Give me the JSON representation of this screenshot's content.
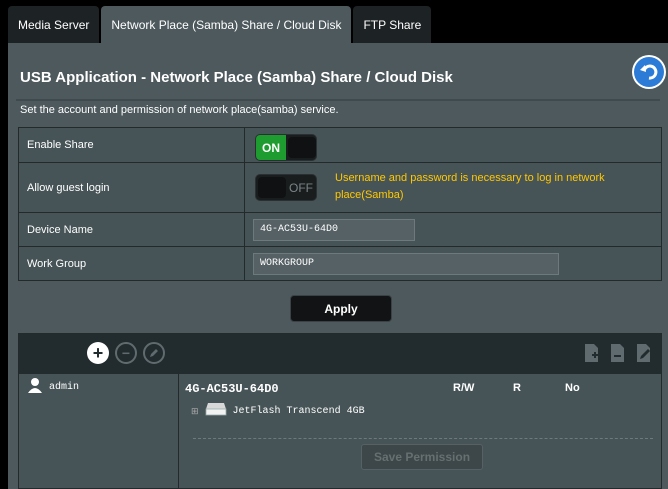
{
  "tabs": [
    {
      "label": "Media Server"
    },
    {
      "label": "Network Place (Samba) Share / Cloud Disk"
    },
    {
      "label": "FTP Share"
    }
  ],
  "page_title": "USB Application - Network Place (Samba) Share / Cloud Disk",
  "description": "Set the account and permission of network place(samba) service.",
  "settings": {
    "enable_share": {
      "label": "Enable Share",
      "state": "ON"
    },
    "guest_login": {
      "label": "Allow guest login",
      "state": "OFF",
      "note": "Username and password is necessary to log in network place(Samba)"
    },
    "device_name": {
      "label": "Device Name",
      "value": "4G-AC53U-64D0"
    },
    "work_group": {
      "label": "Work Group",
      "value": "WORKGROUP"
    }
  },
  "apply_label": "Apply",
  "accounts": [
    {
      "name": "admin"
    }
  ],
  "device": "4G-AC53U-64D0",
  "permission_headers": [
    "R/W",
    "R",
    "No"
  ],
  "disk": "JetFlash Transcend 4GB",
  "save_permission_label": "Save Permission",
  "colors": {
    "accent_green": "#1e9c30",
    "note_yellow": "#ffc800",
    "panel": "#4d595d"
  }
}
